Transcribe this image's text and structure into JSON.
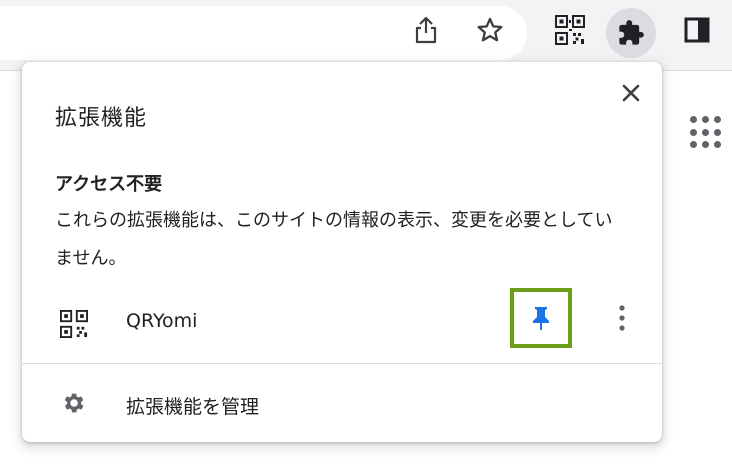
{
  "toolbar": {
    "icons": [
      "share-icon",
      "star-icon",
      "qr-code-icon",
      "puzzle-icon",
      "side-panel-icon"
    ]
  },
  "popup": {
    "title": "拡張機能",
    "section_heading": "アクセス不要",
    "section_description": "これらの拡張機能は、このサイトの情報の表示、変更を必要としていません。",
    "extension": {
      "name": "QRYomi",
      "pinned": true
    },
    "manage_label": "拡張機能を管理"
  },
  "colors": {
    "toolbar_bg": "#f1f3f4",
    "pin_blue": "#1a73e8",
    "highlight_green": "#6c9e1a",
    "icon_gray": "#5f6368"
  }
}
